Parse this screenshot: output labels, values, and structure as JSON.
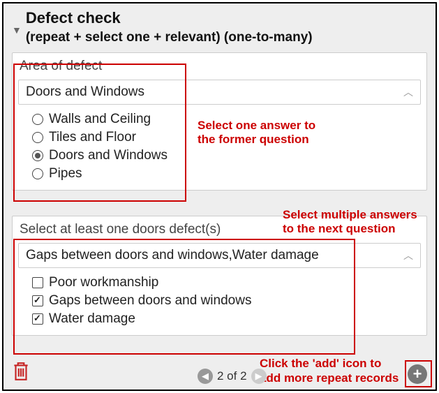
{
  "header": {
    "title": "Defect check",
    "subtitle": "(repeat + select one + relevant) (one-to-many)"
  },
  "group1": {
    "label": "Area of defect",
    "selected": "Doors and Windows",
    "options": [
      {
        "label": "Walls and Ceiling",
        "checked": false
      },
      {
        "label": "Tiles and Floor",
        "checked": false
      },
      {
        "label": "Doors and Windows",
        "checked": true
      },
      {
        "label": "Pipes",
        "checked": false
      }
    ]
  },
  "group2": {
    "label": "Select at least one doors defect(s)",
    "selected": "Gaps between doors and windows,Water damage",
    "options": [
      {
        "label": "Poor workmanship",
        "checked": false
      },
      {
        "label": "Gaps between doors and windows",
        "checked": true
      },
      {
        "label": "Water damage",
        "checked": true
      }
    ]
  },
  "pager": {
    "text": "2 of 2"
  },
  "annotations": {
    "a1_line1": "Select one answer to",
    "a1_line2": "the former question",
    "a2_line1": "Select multiple answers",
    "a2_line2": "to the next question",
    "a3_line1": "Click the 'add' icon to",
    "a3_line2": "add more repeat records"
  }
}
